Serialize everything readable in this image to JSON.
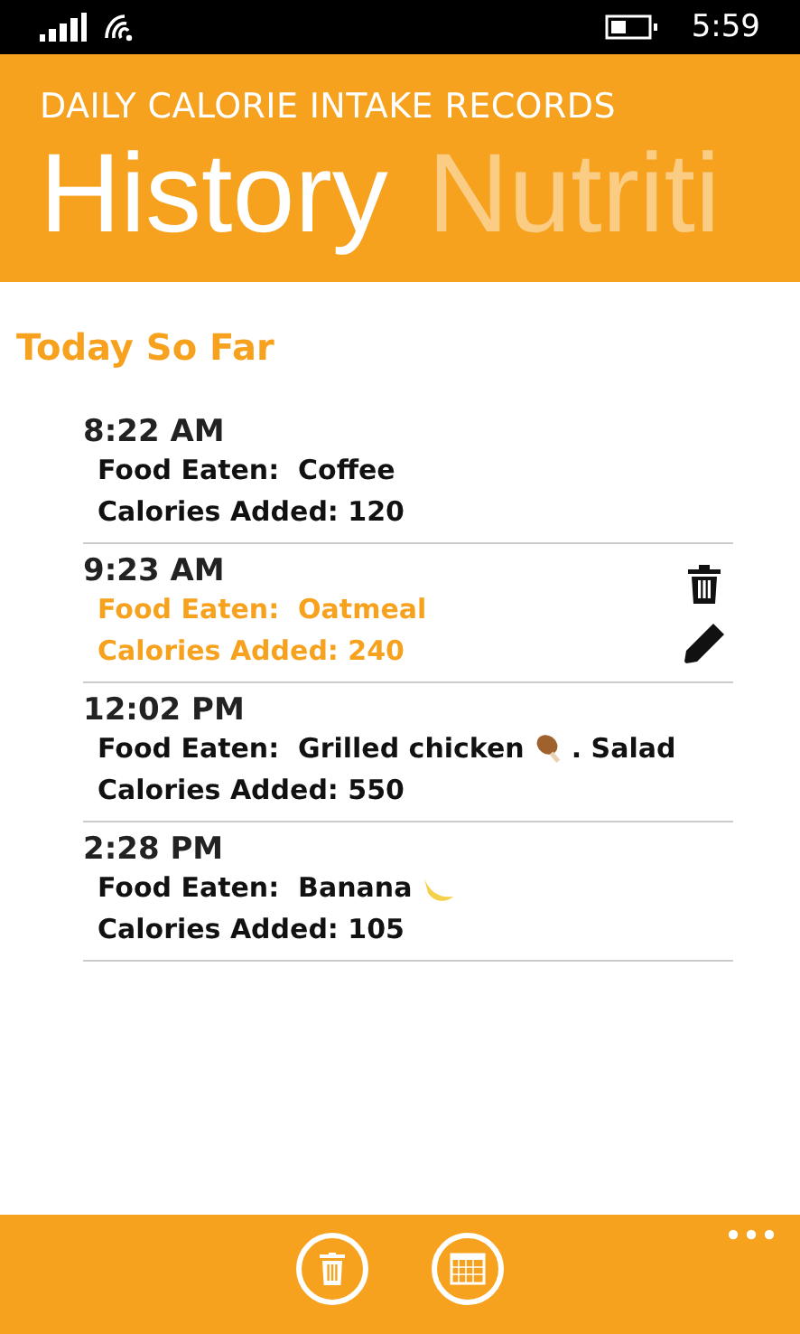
{
  "status_bar": {
    "time": "5:59"
  },
  "app": {
    "title": "DAILY CALORIE INTAKE RECORDS"
  },
  "pivots": [
    {
      "label": "History",
      "selected": true
    },
    {
      "label": "Nutriti",
      "selected": false
    }
  ],
  "section": {
    "title": "Today So Far"
  },
  "entries": [
    {
      "time": "8:22 AM",
      "food_label": "Food Eaten:",
      "food": "Coffee",
      "calories_label": "Calories Added:",
      "calories": "120",
      "selected": false
    },
    {
      "time": "9:23 AM",
      "food_label": "Food Eaten:",
      "food": "Oatmeal",
      "calories_label": "Calories Added:",
      "calories": "240",
      "selected": true
    },
    {
      "time": "12:02 PM",
      "food_label": "Food Eaten:",
      "food": "Grilled chicken",
      "food_icon": {
        "kind": "drumstick"
      },
      "food_suffix": ". Salad",
      "calories_label": "Calories Added:",
      "calories": "550",
      "selected": false
    },
    {
      "time": "2:28 PM",
      "food_label": "Food Eaten:",
      "food": "Banana",
      "food_icon": {
        "kind": "banana"
      },
      "calories_label": "Calories Added:",
      "calories": "105",
      "selected": false
    }
  ],
  "app_bar": {
    "buttons": [
      {
        "kind": "delete"
      },
      {
        "kind": "calendar"
      }
    ]
  }
}
